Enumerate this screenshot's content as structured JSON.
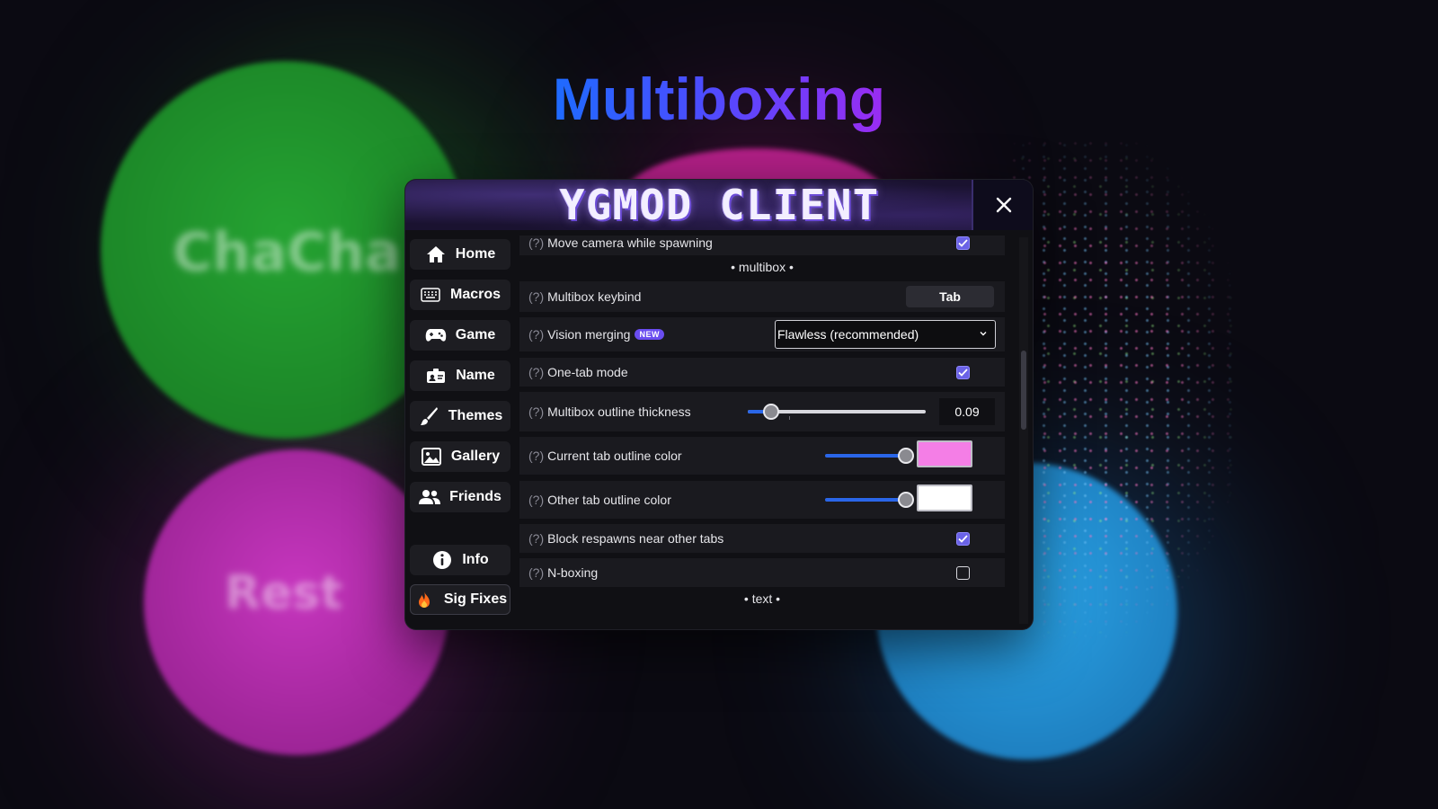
{
  "page": {
    "headline": "Multiboxing"
  },
  "background": {
    "blobs": [
      {
        "name": "ChaCha",
        "color": "#1f8f2a"
      },
      {
        "name": "Rest",
        "color": "#b42cab"
      },
      {
        "name": "",
        "color": "#1f8fd0"
      },
      {
        "name": "",
        "color": "#c01f8f"
      }
    ]
  },
  "window": {
    "title": "YGMOD CLIENT",
    "close_icon": "close-icon"
  },
  "sidebar": {
    "items": [
      {
        "label": "Home",
        "icon": "home-icon"
      },
      {
        "label": "Macros",
        "icon": "keyboard-icon"
      },
      {
        "label": "Game",
        "icon": "gamepad-icon"
      },
      {
        "label": "Name",
        "icon": "id-card-icon"
      },
      {
        "label": "Themes",
        "icon": "brush-icon"
      },
      {
        "label": "Gallery",
        "icon": "image-icon"
      },
      {
        "label": "Friends",
        "icon": "users-icon"
      }
    ],
    "bottom_items": [
      {
        "label": "Info",
        "icon": "info-icon"
      },
      {
        "label": "Sig Fixes",
        "icon": "fire-icon"
      }
    ]
  },
  "settings": {
    "help_marker": "(?)",
    "move_camera": {
      "label": "Move camera while spawning",
      "checked": true
    },
    "section_multibox": "• multibox •",
    "multibox_keybind": {
      "label": "Multibox keybind",
      "value": "Tab"
    },
    "vision_merging": {
      "label": "Vision merging",
      "badge": "NEW",
      "selected": "Flawless (recommended)"
    },
    "one_tab_mode": {
      "label": "One-tab mode",
      "checked": true
    },
    "outline_thickness": {
      "label": "Multibox outline thickness",
      "value": "0.09",
      "fraction": 0.13
    },
    "current_tab_color": {
      "label": "Current tab outline color",
      "color": "#f47ee6",
      "level": 1.0
    },
    "other_tab_color": {
      "label": "Other tab outline color",
      "color": "#ffffff",
      "level": 1.0
    },
    "block_respawns": {
      "label": "Block respawns near other tabs",
      "checked": true
    },
    "n_boxing": {
      "label": "N-boxing",
      "checked": false
    },
    "section_text": "• text •"
  },
  "colors": {
    "accent": "#6a62e6",
    "slider_fill": "#2a66e8",
    "panel_bg": "#101014",
    "row_bg": "#1a1a1f"
  }
}
